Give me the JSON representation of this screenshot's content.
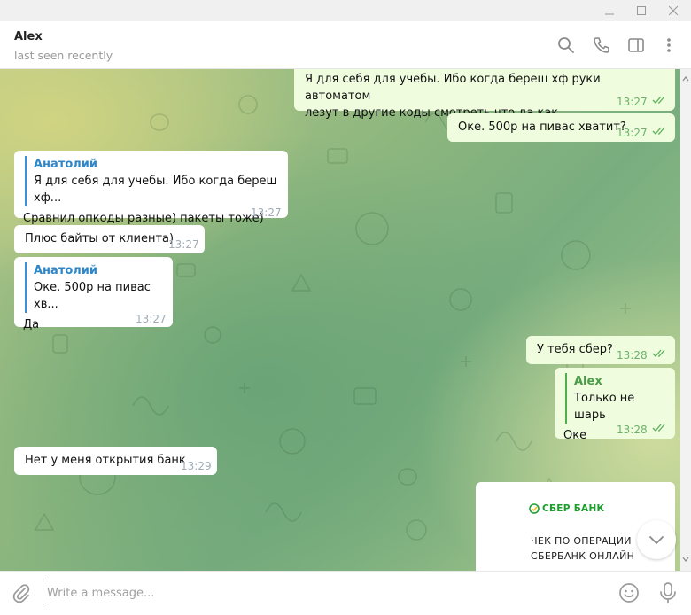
{
  "window": {
    "min": "—",
    "max": "☐",
    "close": "✕"
  },
  "header": {
    "name": "Alex",
    "status": "last seen recently"
  },
  "messages": [
    {
      "dir": "out",
      "text": "Я для себя для учебы. Ибо когда береш хф руки автоматом\nлезут в другие коды смотреть что да как.",
      "time": "13:27"
    },
    {
      "dir": "out",
      "text": "Оке. 500р на пивас хватит?",
      "time": "13:27"
    },
    {
      "dir": "in",
      "reply_name": "Анатолий",
      "reply_text": "Я для себя для учебы. Ибо когда береш хф...",
      "text": "Сравнил опкоды разные) пакеты тоже)",
      "time": "13:27"
    },
    {
      "dir": "in",
      "text": "Плюс байты от клиента)",
      "time": "13:27"
    },
    {
      "dir": "in",
      "reply_name": "Анатолий",
      "reply_text": "Оке. 500р на пивас хв...",
      "text": "Да",
      "time": "13:27"
    },
    {
      "dir": "out",
      "text": "У тебя сбер?",
      "time": "13:28"
    },
    {
      "dir": "out",
      "reply_name": "Alex",
      "reply_text": "Только не шарь",
      "text": "Оке",
      "time": "13:28"
    },
    {
      "dir": "in",
      "text": "Нет у меня открытия банк",
      "time": "13:29"
    }
  ],
  "receipt": {
    "logo": "СБЕР БАНК",
    "line1": "ЧЕК ПО ОПЕРАЦИИ",
    "line2": "СБЕРБАНК ОНЛАЙН"
  },
  "composer": {
    "placeholder": "Write a message..."
  },
  "colors": {
    "incoming": "#ffffff",
    "outgoing": "#effdde",
    "accent": "#2e87c9",
    "check": "#4fae4e"
  }
}
